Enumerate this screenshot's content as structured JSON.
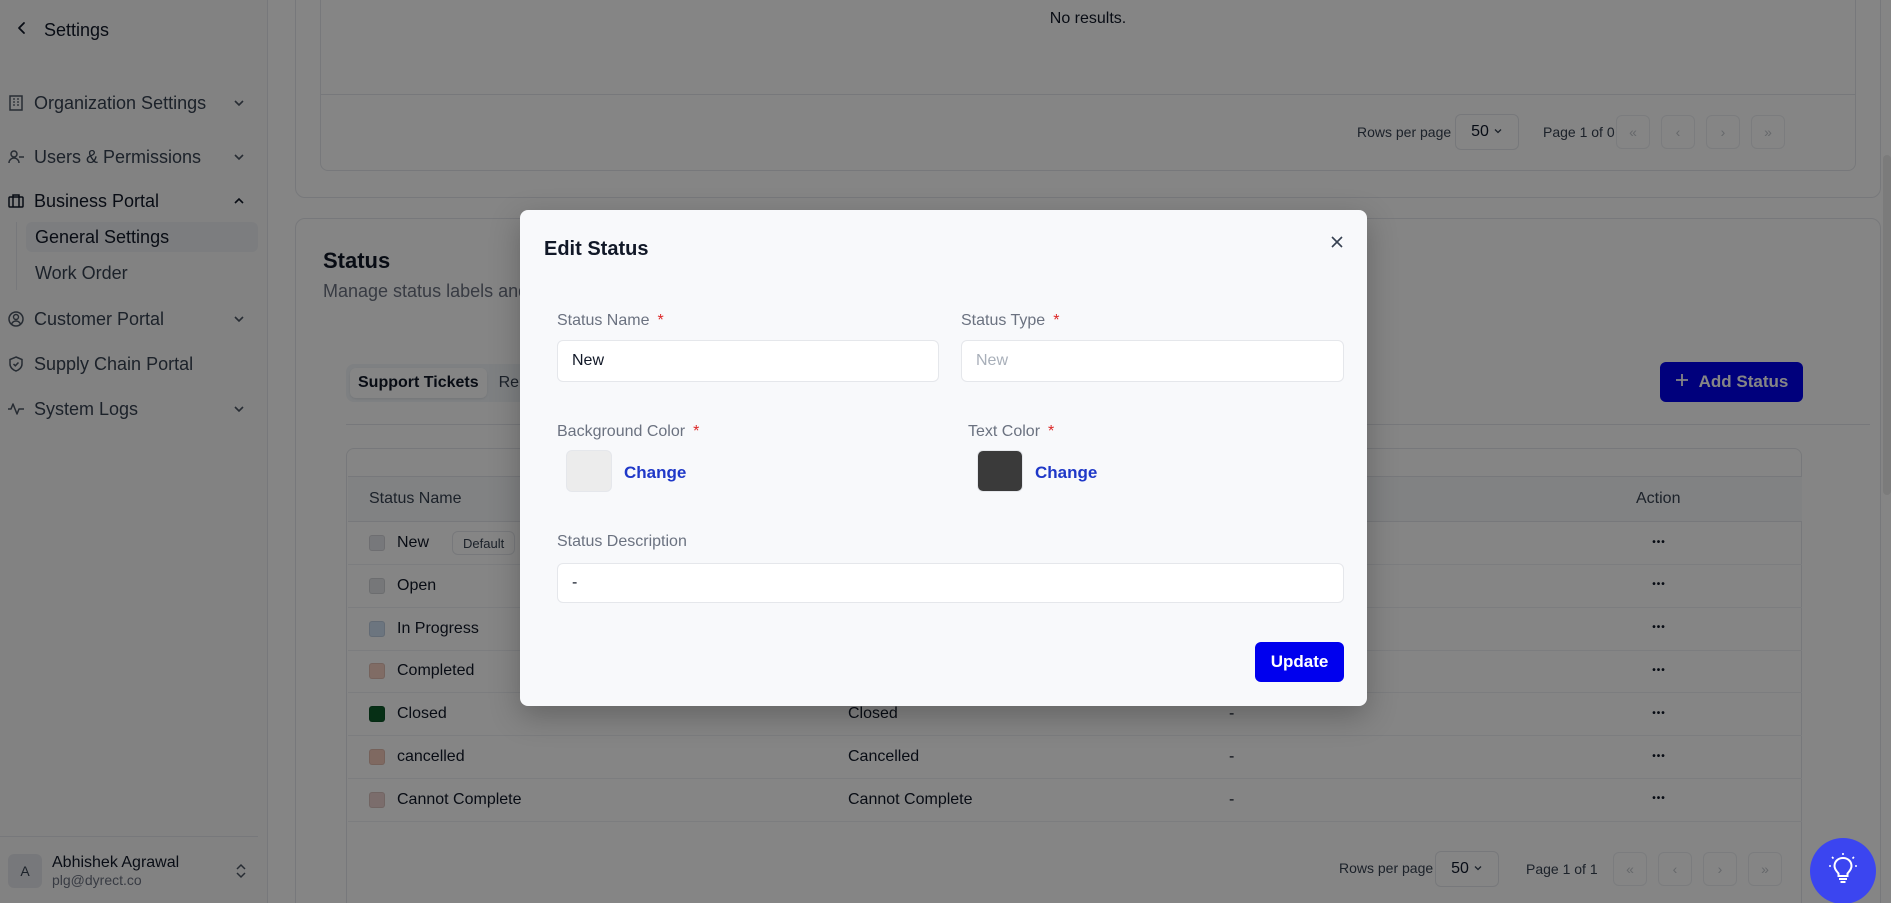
{
  "sidebar": {
    "back_label": "Settings",
    "items": [
      {
        "label": "Organization Settings"
      },
      {
        "label": "Users & Permissions"
      },
      {
        "label": "Business Portal"
      },
      {
        "label": "Customer Portal"
      },
      {
        "label": "Supply Chain Portal"
      },
      {
        "label": "System Logs"
      }
    ],
    "sub_items": [
      {
        "label": "General Settings"
      },
      {
        "label": "Work Order"
      }
    ],
    "user": {
      "initial": "A",
      "name": "Abhishek Agrawal",
      "email": "plg@dyrect.co"
    }
  },
  "top_table": {
    "empty_text": "No results.",
    "rows_per_page_label": "Rows per page",
    "rows_per_page_value": "50",
    "page_info": "Page 1 of 0"
  },
  "status_section": {
    "title": "Status",
    "subtitle": "Manage status labels and",
    "tabs": [
      {
        "label": "Support Tickets"
      },
      {
        "label": "Rep"
      }
    ],
    "add_button": "Add Status",
    "columns": {
      "name": "Status Name",
      "action": "Action"
    },
    "default_badge": "Default",
    "rows": [
      {
        "name": "New",
        "color": "#e5e7eb",
        "type": "",
        "desc": ""
      },
      {
        "name": "Open",
        "color": "#e2e4e8",
        "type": "",
        "desc": ""
      },
      {
        "name": "In Progress",
        "color": "#cfe0f4",
        "type": "",
        "desc": ""
      },
      {
        "name": "Completed",
        "color": "#f5cfc2",
        "type": "",
        "desc": ""
      },
      {
        "name": "Closed",
        "color": "#0d5a2a",
        "type": "Closed",
        "desc": "-"
      },
      {
        "name": "cancelled",
        "color": "#f3cabb",
        "type": "Cancelled",
        "desc": "-"
      },
      {
        "name": "Cannot Complete",
        "color": "#ecd2cf",
        "type": "Cannot Complete",
        "desc": "-"
      }
    ],
    "rows_per_page_label": "Rows per page",
    "rows_per_page_value": "50",
    "page_info": "Page 1 of 1"
  },
  "modal": {
    "title": "Edit Status",
    "status_name_label": "Status Name",
    "status_name_value": "New",
    "status_type_label": "Status Type",
    "status_type_placeholder": "New",
    "bg_color_label": "Background Color",
    "bg_color_value": "#ececec",
    "text_color_label": "Text Color",
    "text_color_value": "#3a3a3a",
    "change_label": "Change",
    "description_label": "Status Description",
    "description_value": "-",
    "required_mark": "*",
    "update_button": "Update"
  },
  "colors": {
    "accent": "#0000ee",
    "fab": "#3b45f0"
  }
}
